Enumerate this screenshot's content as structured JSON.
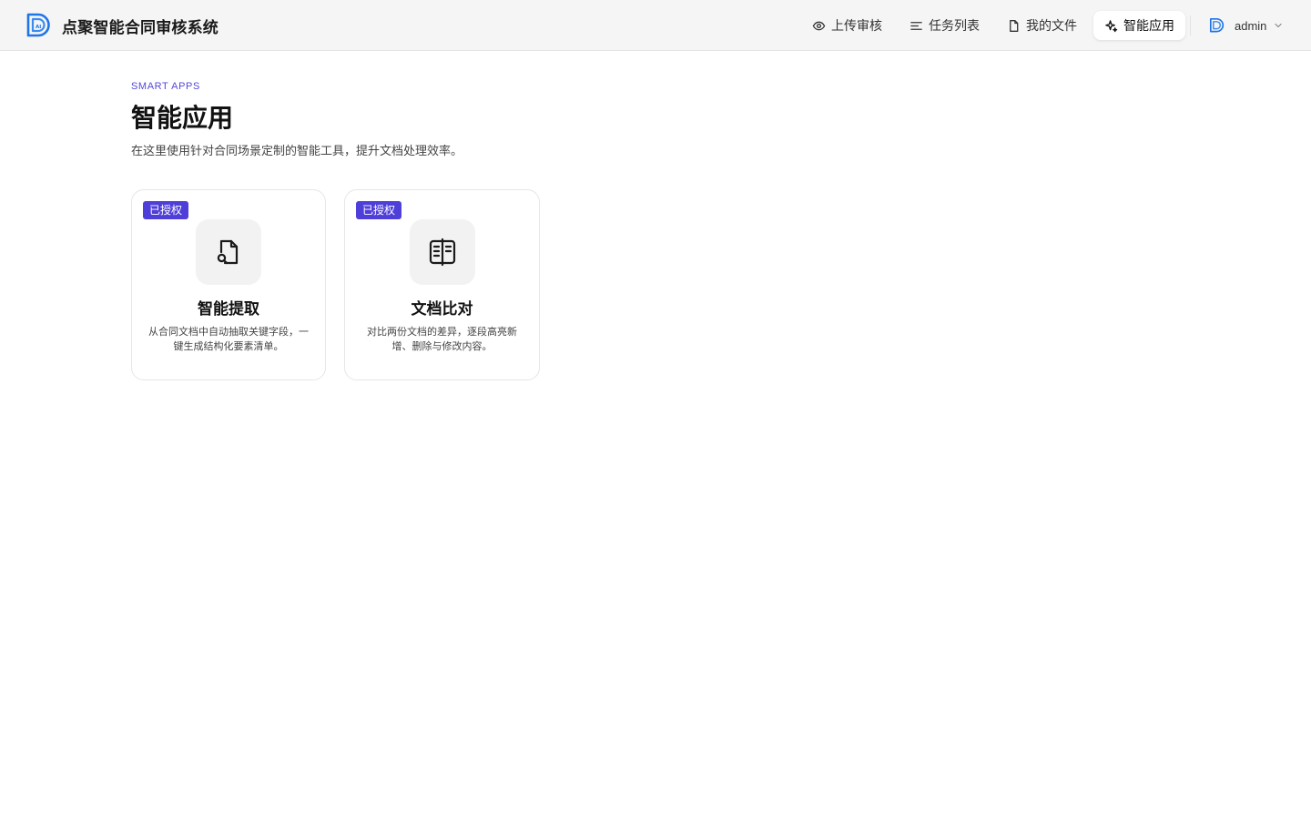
{
  "app": {
    "title": "点聚智能合同审核系统"
  },
  "nav": {
    "items": [
      {
        "label": "上传审核",
        "icon": "eye-icon"
      },
      {
        "label": "任务列表",
        "icon": "list-icon"
      },
      {
        "label": "我的文件",
        "icon": "file-icon"
      },
      {
        "label": "智能应用",
        "icon": "sparkle-icon",
        "active": true
      }
    ]
  },
  "user": {
    "name": "admin"
  },
  "page": {
    "eyebrow": "SMART APPS",
    "title": "智能应用",
    "description": "在这里使用针对合同场景定制的智能工具，提升文档处理效率。"
  },
  "apps": [
    {
      "badge": "已授权",
      "title": "智能提取",
      "description": "从合同文档中自动抽取关键字段，一键生成结构化要素清单。",
      "icon": "file-search-icon"
    },
    {
      "badge": "已授权",
      "title": "文档比对",
      "description": "对比两份文档的差异，逐段高亮新增、删除与修改内容。",
      "icon": "split-book-icon"
    }
  ],
  "colors": {
    "accent": "#4f3fd9",
    "eyebrow": "#5548d9",
    "brand": "#1f74e6",
    "header_bg": "#f5f5f5"
  }
}
